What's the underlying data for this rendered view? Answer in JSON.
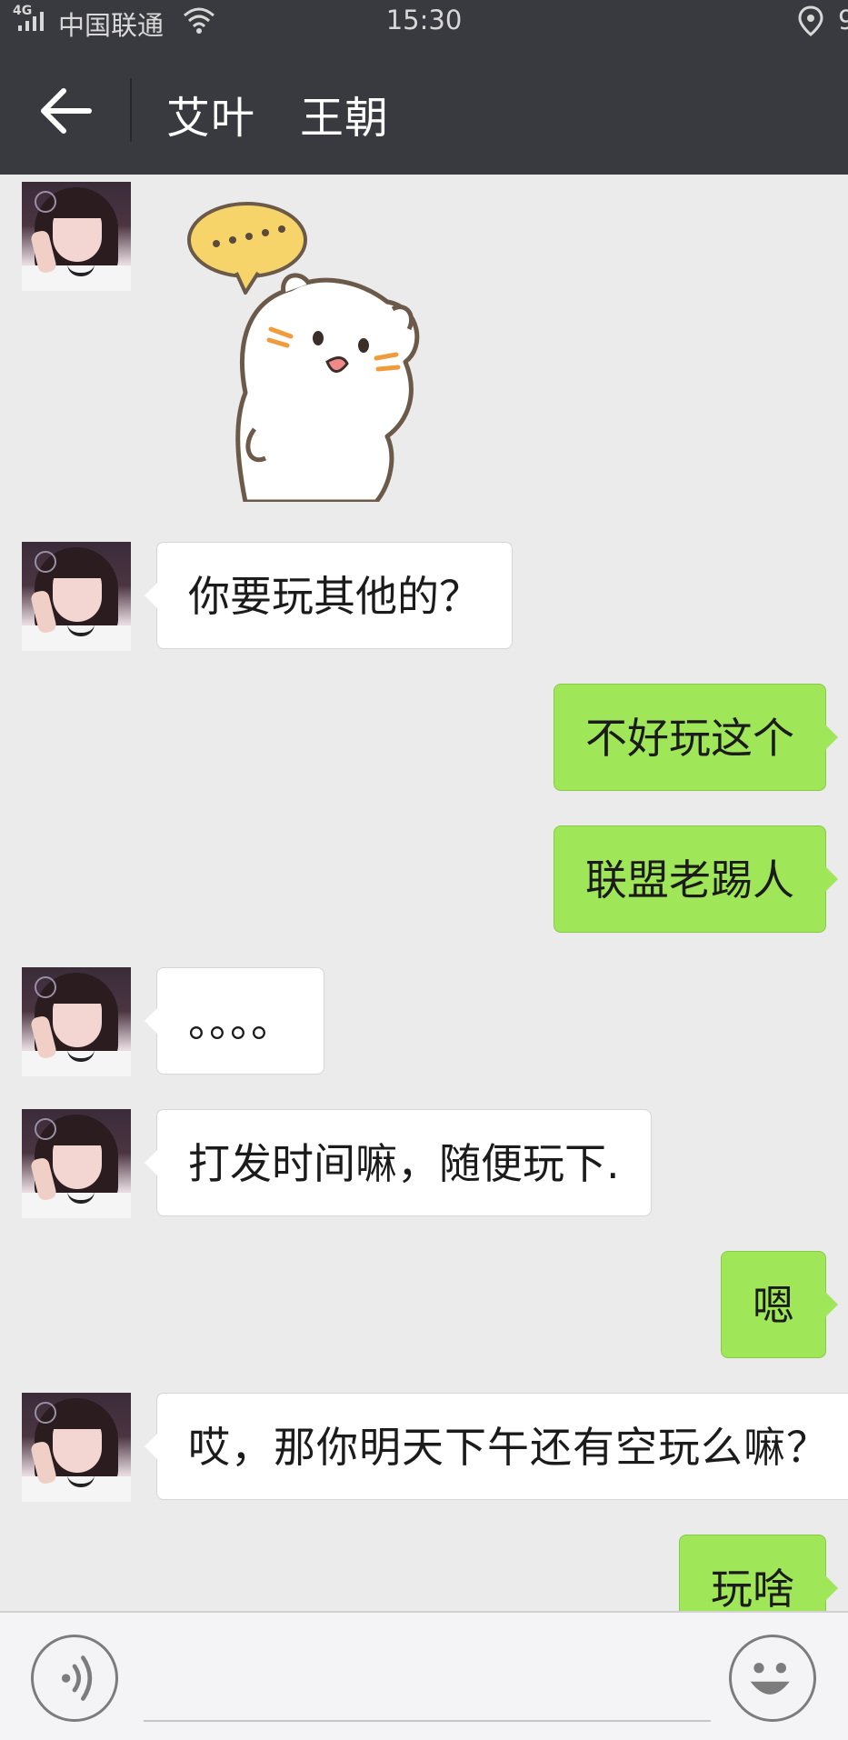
{
  "status_bar": {
    "network": "4G",
    "carrier": "中国联通",
    "time": "15:30",
    "battery_fragment": "9"
  },
  "header": {
    "title": "艾叶　王朝"
  },
  "messages": [
    {
      "side": "left",
      "type": "sticker",
      "sticker_text": "....."
    },
    {
      "side": "left",
      "type": "text",
      "text": "你要玩其他的？"
    },
    {
      "side": "right",
      "type": "text",
      "text": "不好玩这个"
    },
    {
      "side": "right",
      "type": "text",
      "text": "联盟老踢人"
    },
    {
      "side": "left",
      "type": "text",
      "text": "。。。。"
    },
    {
      "side": "left",
      "type": "text",
      "text": "打发时间嘛，随便玩下."
    },
    {
      "side": "right",
      "type": "text",
      "text": "嗯"
    },
    {
      "side": "left",
      "type": "text",
      "text": "哎，那你明天下午还有空玩么嘛？"
    },
    {
      "side": "right",
      "type": "text",
      "text": "玩啥"
    }
  ],
  "input_bar": {
    "value": "",
    "placeholder": "",
    "icons": [
      "voice-icon",
      "emoji-icon"
    ]
  },
  "colors": {
    "header_bg": "#393a3f",
    "chat_bg": "#ebebeb",
    "bubble_incoming": "#ffffff",
    "bubble_outgoing": "#9fe658"
  }
}
